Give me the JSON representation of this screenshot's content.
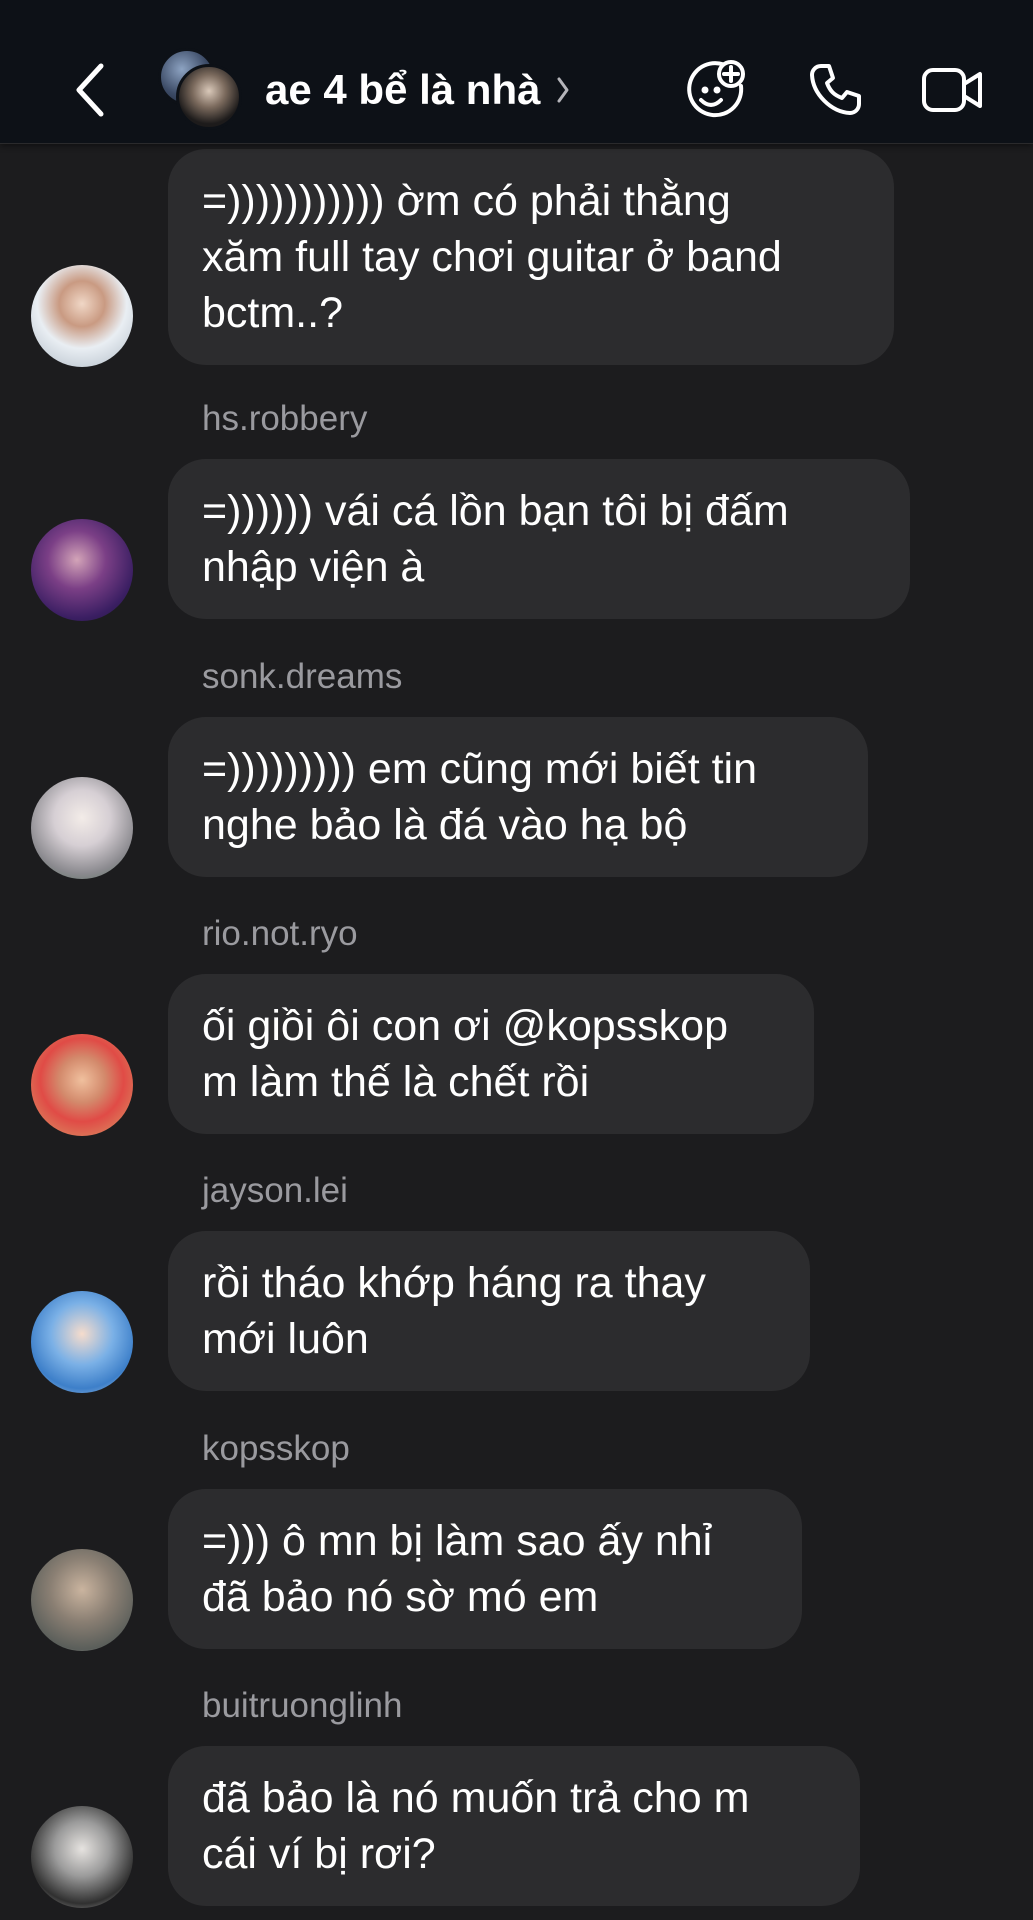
{
  "header": {
    "title": "ae 4 bể là nhà",
    "icons": {
      "back": "chevron-left-icon",
      "title_chevron": "chevron-right-icon",
      "effects": "sticker-effects-icon",
      "call": "phone-icon",
      "video": "video-camera-icon"
    }
  },
  "colors": {
    "background": "#1c1c1e",
    "header_background": "#0d1117",
    "bubble": "#2c2c2e",
    "sender_text": "#9a9a9f",
    "message_text": "#ffffff"
  },
  "messages": [
    {
      "sender": "",
      "text": "=))))))))))) ờm có phải thằng\nxăm full tay chơi guitar ở band\nbctm..?"
    },
    {
      "sender": "hs.robbery",
      "text": "=)))))) vái cá lồn bạn tôi bị đấm\nnhập viện à"
    },
    {
      "sender": "sonk.dreams",
      "text": "=))))))))) em cũng mới biết tin\nnghe bảo là đá vào hạ bộ"
    },
    {
      "sender": "rio.not.ryo",
      "text": "ối giồi ôi con ơi @kopsskop\nm làm thế là chết rồi"
    },
    {
      "sender": "jayson.lei",
      "text": "rồi tháo khớp háng ra thay\nmới luôn"
    },
    {
      "sender": "kopsskop",
      "text": "=))) ô mn bị làm sao ấy nhỉ\nđã bảo nó sờ mó em"
    },
    {
      "sender": "buitruonglinh",
      "text": "đã bảo là nó muốn trả cho m\ncái ví bị rơi?"
    }
  ]
}
